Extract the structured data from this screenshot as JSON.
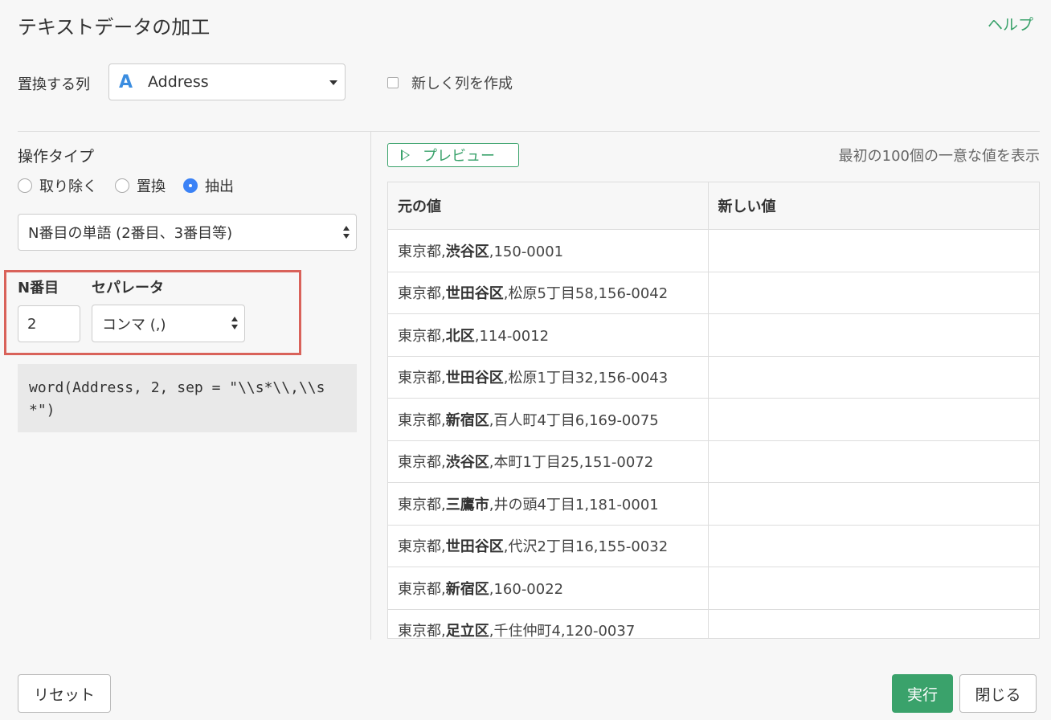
{
  "header": {
    "title": "テキストデータの加工",
    "help_label": "ヘルプ"
  },
  "column": {
    "label": "置換する列",
    "type_icon_letter": "A",
    "selected": "Address",
    "new_column_label": "新しく列を作成"
  },
  "operation": {
    "label": "操作タイプ",
    "options": [
      "取り除く",
      "置換",
      "抽出"
    ],
    "selected_index": 2,
    "method_selected": "N番目の単語 (2番目、3番目等)"
  },
  "params": {
    "nth_label": "N番目",
    "nth_value": "2",
    "separator_label": "セパレータ",
    "separator_selected": "コンマ (,)"
  },
  "code": "word(Address, 2, sep = \"\\\\s*\\\\,\\\\s*\")",
  "preview": {
    "button_label": "プレビュー",
    "note": "最初の100個の一意な値を表示",
    "headers": [
      "元の値",
      "新しい値"
    ],
    "rows": [
      {
        "pre": "東京都,",
        "bold": "渋谷区",
        "post": ",150-0001",
        "new": ""
      },
      {
        "pre": "東京都,",
        "bold": "世田谷区",
        "post": ",松原5丁目58,156-0042",
        "new": ""
      },
      {
        "pre": "東京都,",
        "bold": "北区",
        "post": ",114-0012",
        "new": ""
      },
      {
        "pre": "東京都,",
        "bold": "世田谷区",
        "post": ",松原1丁目32,156-0043",
        "new": ""
      },
      {
        "pre": "東京都,",
        "bold": "新宿区",
        "post": ",百人町4丁目6,169-0075",
        "new": ""
      },
      {
        "pre": "東京都,",
        "bold": "渋谷区",
        "post": ",本町1丁目25,151-0072",
        "new": ""
      },
      {
        "pre": "東京都,",
        "bold": "三鷹市",
        "post": ",井の頭4丁目1,181-0001",
        "new": ""
      },
      {
        "pre": "東京都,",
        "bold": "世田谷区",
        "post": ",代沢2丁目16,155-0032",
        "new": ""
      },
      {
        "pre": "東京都,",
        "bold": "新宿区",
        "post": ",160-0022",
        "new": ""
      },
      {
        "pre": "東京都,",
        "bold": "足立区",
        "post": ",千住仲町4,120-0037",
        "new": ""
      }
    ]
  },
  "footer": {
    "reset_label": "リセット",
    "run_label": "実行",
    "close_label": "閉じる"
  },
  "colors": {
    "accent_green": "#3aa26b",
    "radio_blue": "#3b82f6",
    "column_type_blue": "#3b8de0",
    "highlight_red": "#d9625a"
  }
}
